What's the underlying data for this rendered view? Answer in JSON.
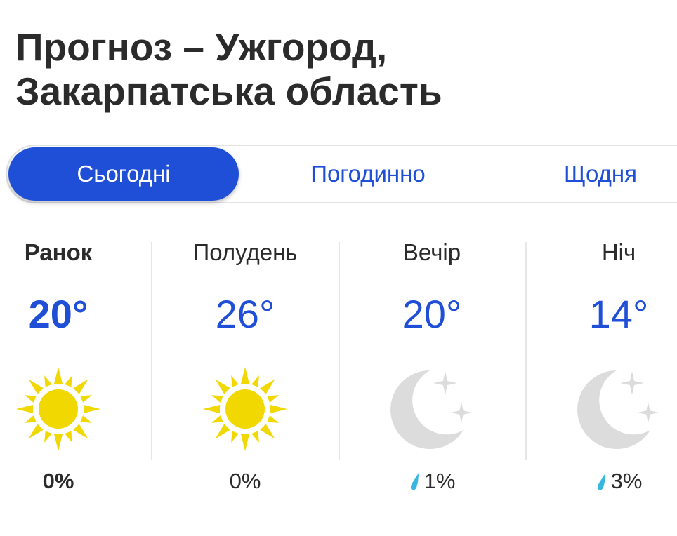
{
  "title": {
    "line1": "Прогноз – Ужгород,",
    "line2": "Закарпатська область"
  },
  "tabs": [
    {
      "label": "Сьогодні",
      "active": true
    },
    {
      "label": "Погодинно",
      "active": false
    },
    {
      "label": "Щодня",
      "active": false
    }
  ],
  "periods": [
    {
      "name": "Ранок",
      "temp": "20°",
      "icon": "sun-icon",
      "precip": "0%",
      "rain_drop": false
    },
    {
      "name": "Полудень",
      "temp": "26°",
      "icon": "sun-icon",
      "precip": "0%",
      "rain_drop": false
    },
    {
      "name": "Вечір",
      "temp": "20°",
      "icon": "moon-stars-icon",
      "precip": "1%",
      "rain_drop": true
    },
    {
      "name": "Ніч",
      "temp": "14°",
      "icon": "moon-stars-icon",
      "precip": "3%",
      "rain_drop": true
    }
  ],
  "colors": {
    "accent": "#1f4fd6",
    "sun": "#f0d800",
    "moon": "#dcdcdc",
    "drop": "#39b6e0"
  }
}
